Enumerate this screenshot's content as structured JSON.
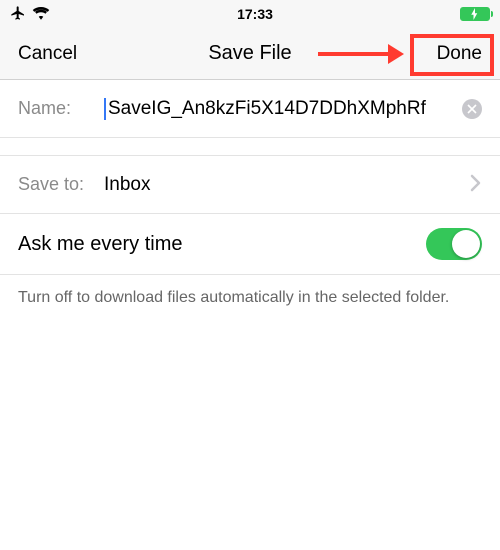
{
  "status": {
    "time": "17:33"
  },
  "header": {
    "cancel": "Cancel",
    "title": "Save File",
    "done": "Done"
  },
  "name_row": {
    "label": "Name:",
    "value": "SaveIG_An8kzFi5X14D7DDhXMphRf"
  },
  "saveto_row": {
    "label": "Save to:",
    "value": "Inbox"
  },
  "toggle": {
    "label": "Ask me every time",
    "on": true
  },
  "footer": "Turn off to download files automatically in the selected folder.",
  "colors": {
    "highlight": "#ff3b30",
    "toggle_on": "#34c759"
  }
}
